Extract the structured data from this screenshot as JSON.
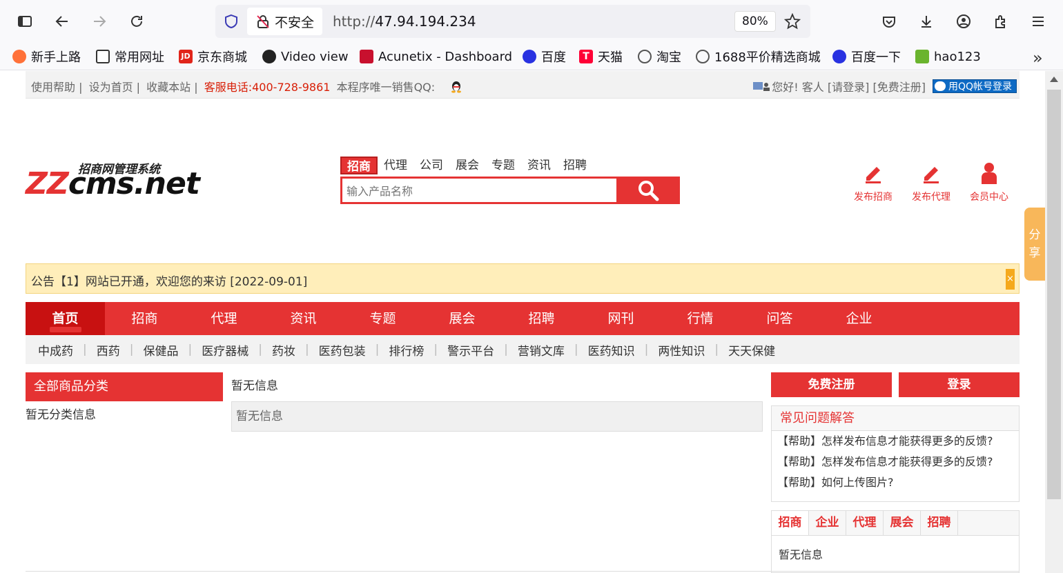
{
  "browser": {
    "insecure_label": "不安全",
    "url_prefix": "http://",
    "url_host": "47.94.194.234",
    "zoom": "80%",
    "bookmarks": [
      {
        "label": "新手上路",
        "icon": "firefox-icon",
        "color": "#ff7139"
      },
      {
        "label": "常用网址",
        "icon": "folder-icon",
        "color": "#ffffff"
      },
      {
        "label": "京东商城",
        "icon": "jd-icon",
        "color": "#e1251b"
      },
      {
        "label": "Video view",
        "icon": "video-icon",
        "color": "#222222"
      },
      {
        "label": "Acunetix - Dashboard",
        "icon": "acunetix-icon",
        "color": "#c8102e"
      },
      {
        "label": "百度",
        "icon": "baidu-paw-icon",
        "color": "#2932e1"
      },
      {
        "label": "天猫",
        "icon": "tmall-icon",
        "color": "#ff0036"
      },
      {
        "label": "淘宝",
        "icon": "globe-icon",
        "color": "#555555"
      },
      {
        "label": "1688平价精选商城",
        "icon": "globe-icon",
        "color": "#555555"
      },
      {
        "label": "百度一下",
        "icon": "baidu-paw-icon",
        "color": "#2932e1"
      },
      {
        "label": "hao123",
        "icon": "hao123-icon",
        "color": "#6ab42e"
      }
    ]
  },
  "topbar": {
    "links": [
      "使用帮助 |",
      "设为首页 |",
      "收藏本站 |"
    ],
    "hotline": "客服电话:400-728-9861",
    "qq_text": "本程序唯一销售QQ:",
    "greeting": "您好!  客人 [请登录] [免费注册]",
    "qq_login": "用QQ帐号登录"
  },
  "logo": {
    "slogan": "招商网管理系统",
    "brand_prefix": "ZZ",
    "brand_rest": "cms.net"
  },
  "search": {
    "tabs": [
      "招商",
      "代理",
      "公司",
      "展会",
      "专题",
      "资讯",
      "招聘"
    ],
    "placeholder": "输入产品名称"
  },
  "quick_links": [
    "发布招商",
    "发布代理",
    "会员中心"
  ],
  "notice": {
    "text": "公告【1】网站已开通，欢迎您的来访 [2022-09-01]",
    "close": "×"
  },
  "main_nav": [
    "首页",
    "招商",
    "代理",
    "资讯",
    "专题",
    "展会",
    "招聘",
    "网刊",
    "行情",
    "问答",
    "企业"
  ],
  "sub_nav": [
    "中成药",
    "西药",
    "保健品",
    "医疗器械",
    "药妆",
    "医药包装",
    "排行榜",
    "警示平台",
    "营销文库",
    "医药知识",
    "两性知识",
    "天天保健"
  ],
  "category": {
    "title": "全部商品分类",
    "empty": "暂无分类信息"
  },
  "center": {
    "label": "暂无信息",
    "box_text": "暂无信息"
  },
  "sidebar": {
    "register": "免费注册",
    "login": "登录",
    "faq_title": "常见问题解答",
    "faq_items": [
      "【帮助】怎样发布信息才能获得更多的反馈?",
      "【帮助】怎样发布信息才能获得更多的反馈?",
      "【帮助】如何上传图片?"
    ],
    "tabs": [
      "招商",
      "企业",
      "代理",
      "展会",
      "招聘"
    ],
    "tab_empty": "暂无信息"
  },
  "share": "分享",
  "colors": {
    "brand_red": "#e53333",
    "notice_bg": "#ffeeba",
    "share_orange": "#f8b75a"
  }
}
